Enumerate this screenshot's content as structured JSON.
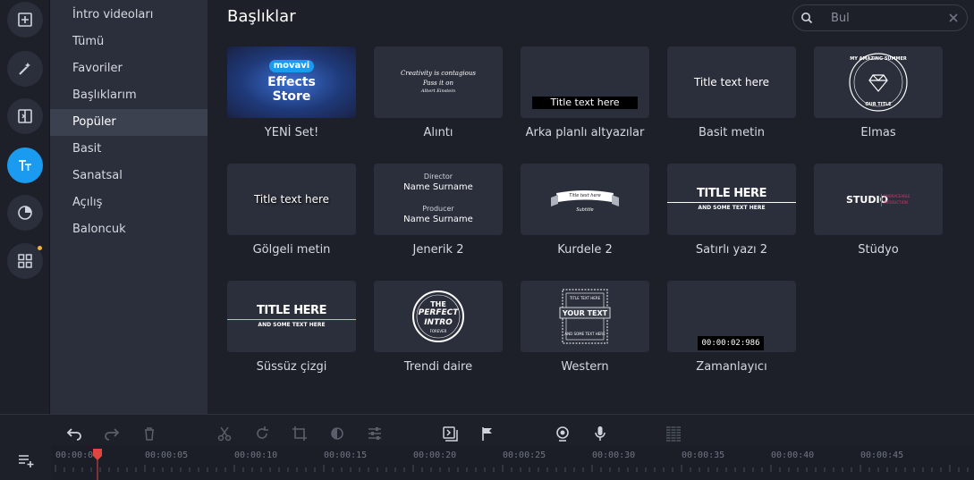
{
  "rail": {
    "items": [
      {
        "name": "import-icon"
      },
      {
        "name": "magic-wand-icon"
      },
      {
        "name": "transitions-icon"
      },
      {
        "name": "titles-icon"
      },
      {
        "name": "stickers-icon"
      },
      {
        "name": "more-tools-icon"
      }
    ],
    "active": "titles-icon"
  },
  "categories": {
    "items": [
      "İntro videoları",
      "Tümü",
      "Favoriler",
      "Başlıklarım",
      "Popüler",
      "Basit",
      "Sanatsal",
      "Açılış",
      "Baloncuk"
    ],
    "selected": "Popüler"
  },
  "main": {
    "title": "Başlıklar",
    "search_placeholder": "Bul"
  },
  "tiles": [
    {
      "label": "YENİ Set!",
      "badge": "movavi",
      "line1": "Effects",
      "line2": "Store"
    },
    {
      "label": "Alıntı",
      "line1": "Creativity is contagious",
      "line2": "Pass it on",
      "line3": "Albert Einstein"
    },
    {
      "label": "Arka planlı altyazılar",
      "line1": "Title text here"
    },
    {
      "label": "Basit metin",
      "line1": "Title text here"
    },
    {
      "label": "Elmas",
      "line1": "MY AMAZING SUMMER",
      "line2": "OUR TITLE"
    },
    {
      "label": "Gölgeli metin",
      "line1": "Title text here"
    },
    {
      "label": "Jenerik 2",
      "line1": "Director",
      "line2": "Name Surname",
      "line3": "Producer",
      "line4": "Name Surname"
    },
    {
      "label": "Kurdele 2",
      "line1": "Title text here",
      "line2": "Subtitle"
    },
    {
      "label": "Satırlı yazı 2",
      "line1": "TITLE HERE",
      "line2": "AND SOME TEXT HERE"
    },
    {
      "label": "Stüdyo",
      "line1": "STUDIO",
      "line2": "EMBRACEABLE",
      "line3": "PRODUCTION"
    },
    {
      "label": "Süssüz çizgi",
      "line1": "TITLE HERE",
      "line2": "AND SOME TEXT HERE"
    },
    {
      "label": "Trendi daire",
      "line1": "THE",
      "line2": "PERFECT",
      "line3": "INTRO",
      "line4": "FOREVER"
    },
    {
      "label": "Western",
      "line1": "YOUR TEXT",
      "line2": "TITLE TEXT HERE",
      "line3": "AND SOME TEXT HERE"
    },
    {
      "label": "Zamanlayıcı",
      "line1": "00:00:02:986"
    }
  ],
  "timeline": {
    "tick_labels": [
      "00:00:00",
      "00:00:05",
      "00:00:10",
      "00:00:15",
      "00:00:20",
      "00:00:25",
      "00:00:30",
      "00:00:35",
      "00:00:40",
      "00:00:45"
    ],
    "playhead_color": "#e0453e"
  },
  "colors": {
    "accent": "#1a9bf0",
    "panel": "#2b2f3b",
    "background": "#1d2029"
  }
}
